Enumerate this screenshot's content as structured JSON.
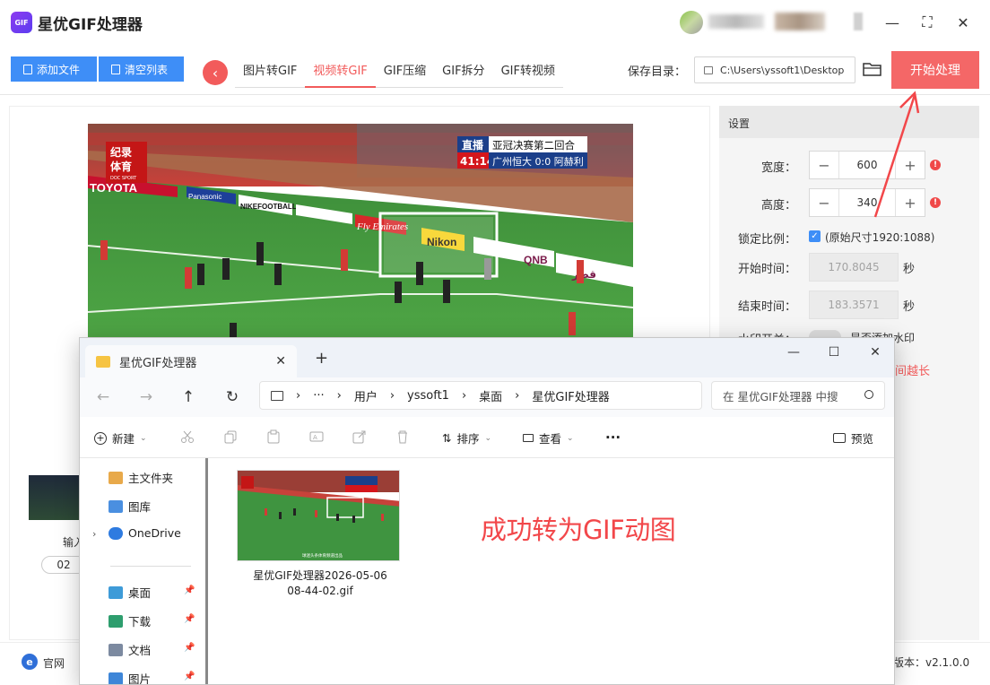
{
  "app": {
    "title": "星优GIF处理器",
    "logo_text": "GIF"
  },
  "window_controls": {
    "minimize": "—",
    "maximize": "⛶",
    "close": "✕"
  },
  "toolbar": {
    "add_files": "添加文件",
    "clear_list": "清空列表",
    "back": "‹",
    "tabs": [
      {
        "label": "图片转GIF",
        "active": false
      },
      {
        "label": "视频转GIF",
        "active": true
      },
      {
        "label": "GIF压缩",
        "active": false
      },
      {
        "label": "GIF拆分",
        "active": false
      },
      {
        "label": "GIF转视频",
        "active": false
      }
    ],
    "save_dir_label": "保存目录：",
    "save_dir_path": "C:\\Users\\yssoft1\\Desktop",
    "start_button": "开始处理"
  },
  "video_overlay": {
    "channel_line1": "纪录",
    "channel_line2": "体育",
    "channel_sub": "DOC SPORT",
    "live": "直播",
    "match_title": "亚冠决赛第二回合",
    "clock": "41:14",
    "score": "广州恒大 0:0 阿赫利",
    "ads": [
      "TOYOTA",
      "Panasonic",
      "NIKEFOOTBALL",
      "Fly Emirates",
      "Nikon",
      "QNB",
      "قطر"
    ]
  },
  "settings": {
    "header": "设置",
    "width_label": "宽度：",
    "width_value": "600",
    "height_label": "高度：",
    "height_value": "340",
    "lock_label": "锁定比例：",
    "lock_checked": true,
    "original_size": "(原始尺寸1920:1088)",
    "start_label": "开始时间：",
    "start_value": "170.8045",
    "start_unit": "秒",
    "end_label": "结束时间：",
    "end_value": "183.3571",
    "end_unit": "秒",
    "watermark_label": "水印开关：",
    "watermark_text": "是否添加水印",
    "warning_tail": "间越长",
    "minus": "−",
    "plus": "+",
    "warn": "!"
  },
  "left_list": {
    "item_label": "输入",
    "item_index": "02"
  },
  "footer": {
    "site_icon": "e",
    "site": "官网",
    "version": "版本：v2.1.0.0"
  },
  "annotation": "成功转为GIF动图",
  "explorer": {
    "tab_title": "星优GIF处理器",
    "new_tab": "+",
    "tab_close": "✕",
    "controls": {
      "minimize": "—",
      "maximize": "☐",
      "close": "✕"
    },
    "nav": {
      "back": "←",
      "forward": "→",
      "up": "↑",
      "refresh": "↻"
    },
    "breadcrumb": [
      "›",
      "···",
      "›",
      "用户",
      "›",
      "yssoft1",
      "›",
      "桌面",
      "›",
      "星优GIF处理器"
    ],
    "search_placeholder": "在 星优GIF处理器 中搜",
    "commands": {
      "new": "新建",
      "sort": "排序",
      "view": "查看",
      "more": "···",
      "preview": "预览"
    },
    "sidebar": [
      {
        "label": "主文件夹",
        "pinned": false,
        "color": "#e8a94a"
      },
      {
        "label": "图库",
        "pinned": false,
        "color": "#4a8fe0"
      },
      {
        "label": "OneDrive",
        "pinned": false,
        "color": "#2e7be0"
      },
      {
        "label": "桌面",
        "pinned": true,
        "color": "#3e9bd8"
      },
      {
        "label": "下载",
        "pinned": true,
        "color": "#2e9e6e"
      },
      {
        "label": "文档",
        "pinned": true,
        "color": "#7c8aa0"
      },
      {
        "label": "图片",
        "pinned": true,
        "color": "#3e86d8"
      }
    ],
    "file": {
      "name": "星优GIF处理器2026-05-06 08-44-02.gif",
      "caption": "球迷头条体育频道出品"
    }
  }
}
